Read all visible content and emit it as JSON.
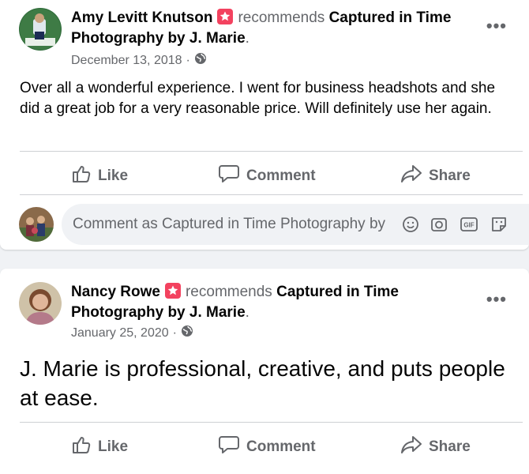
{
  "posts": [
    {
      "author": "Amy Levitt Knutson",
      "recommends": "recommends",
      "page_name_line1": "Captured in Time",
      "page_name_line2": "Photography by J. Marie",
      "period": ".",
      "date": "December 13, 2018",
      "dot": "·",
      "body": "Over all a wonderful experience.  I went for business headshots and she did a great job for a very reasonable price.  Will definitely use her again.",
      "actions": {
        "like": "Like",
        "comment": "Comment",
        "share": "Share"
      },
      "comment_placeholder": "Comment as Captured in Time Photography by",
      "comment_icons": [
        "emoji-icon",
        "camera-icon",
        "gif-icon",
        "sticker-icon"
      ]
    },
    {
      "author": "Nancy Rowe",
      "recommends": "recommends",
      "page_name_line1": "Captured in Time",
      "page_name_line2": "Photography by J. Marie",
      "period": ".",
      "date": "January 25, 2020",
      "dot": "·",
      "body": "J. Marie is professional, creative, and puts people at ease.",
      "actions": {
        "like": "Like",
        "comment": "Comment",
        "share": "Share"
      }
    }
  ],
  "more_label": "•••",
  "colors": {
    "recommend_badge": "#f3425f",
    "secondary_text": "#65676b",
    "background": "#f0f2f5"
  }
}
